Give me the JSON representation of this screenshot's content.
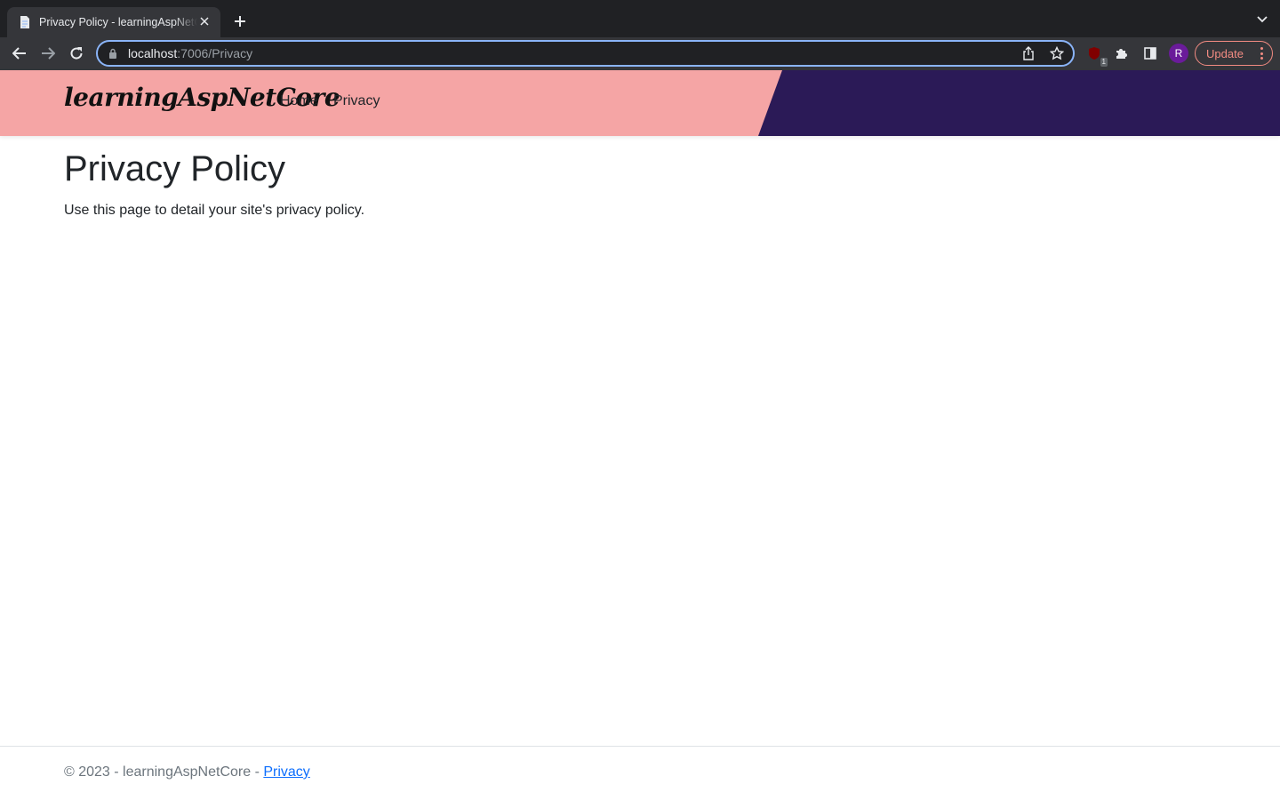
{
  "browser": {
    "tab_title": "Privacy Policy - learningAspNetCore",
    "url_host": "localhost",
    "url_path": ":7006/Privacy",
    "extension_badge": "1",
    "profile_initial": "R",
    "update_label": "Update",
    "icons": {
      "favicon": "document-icon",
      "close": "close-icon",
      "new_tab": "plus-icon",
      "tab_list": "chevron-down-icon",
      "back": "back-arrow-icon",
      "forward": "forward-arrow-icon",
      "reload": "reload-icon",
      "lock": "lock-icon",
      "share": "share-icon",
      "bookmark": "star-icon",
      "extension": "ublock-icon",
      "extensions": "puzzle-icon",
      "side_panel": "side-panel-icon",
      "menu": "kebab-menu-icon"
    }
  },
  "header": {
    "brand": "learningAspNetCore",
    "nav": [
      {
        "label": "Home"
      },
      {
        "label": "Privacy"
      }
    ],
    "colors": {
      "pink": "#f5a5a5",
      "purple": "#2b1a57"
    }
  },
  "main": {
    "title": "Privacy Policy",
    "text": "Use this page to detail your site's privacy policy."
  },
  "footer": {
    "text": "© 2023 - learningAspNetCore - ",
    "link_label": "Privacy"
  }
}
